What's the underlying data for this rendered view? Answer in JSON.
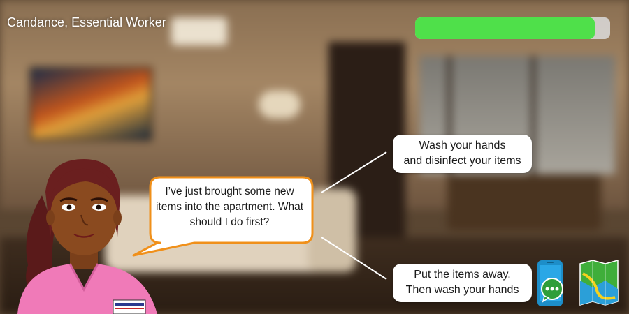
{
  "hud": {
    "character_title": "Candance, Essential Worker",
    "progress_fraction": 0.92,
    "progress_color": "#4fe04a"
  },
  "dialogue": {
    "speech_text": "I’ve just brought some new items into the apartment. What should I do first?",
    "bubble_border_color": "#f0901a"
  },
  "choices": [
    {
      "line1": "Wash your hands",
      "line2": "and disinfect your items"
    },
    {
      "line1": "Put the items away.",
      "line2": "Then wash your hands"
    }
  ],
  "tools": {
    "phone_icon": "phone-chat-icon",
    "map_icon": "map-icon"
  }
}
